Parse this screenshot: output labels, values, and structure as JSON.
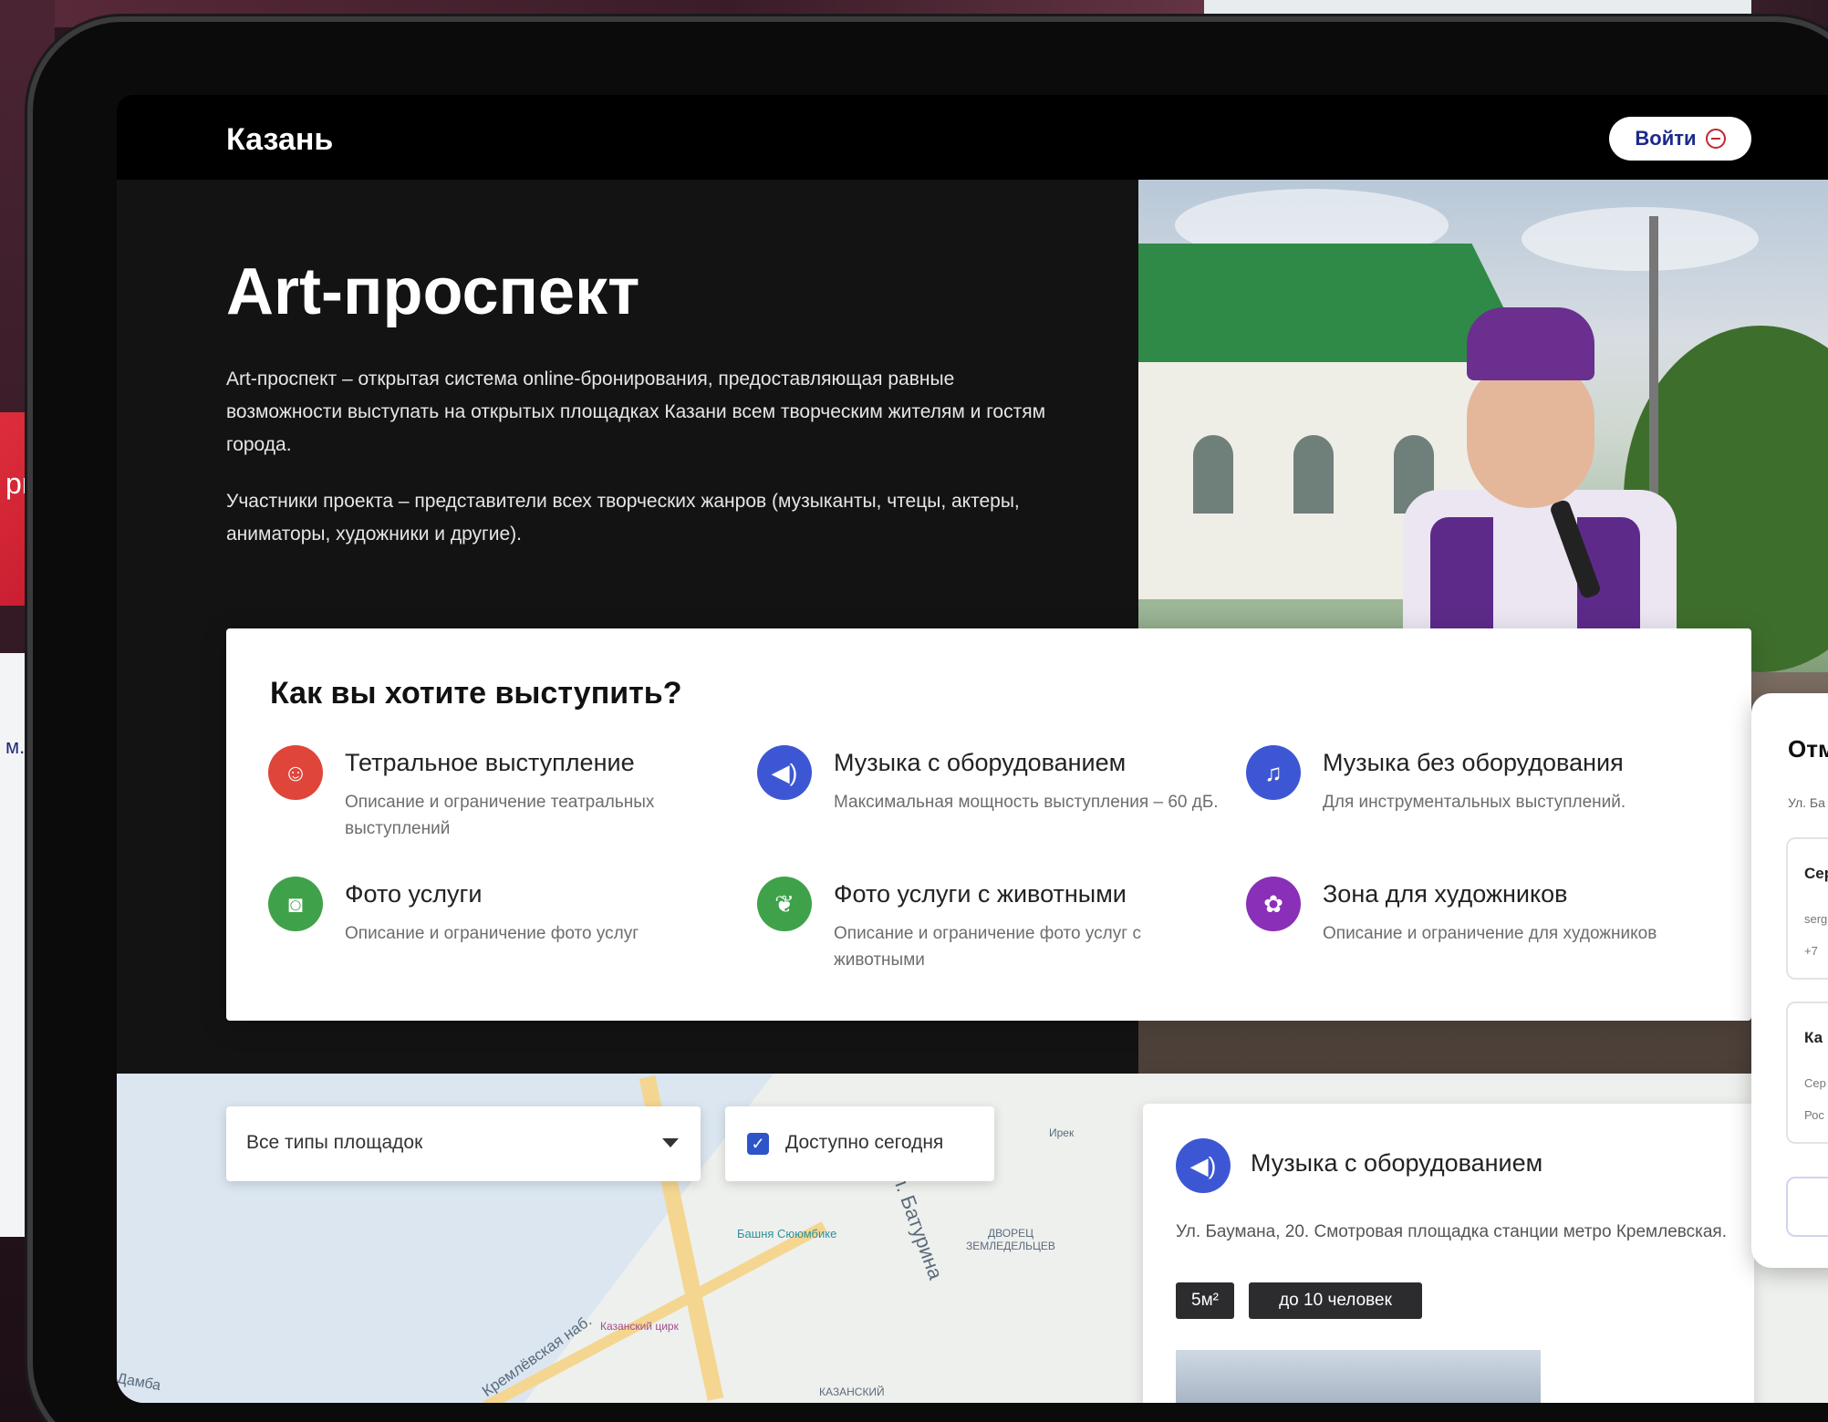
{
  "header": {
    "city": "Казань",
    "login_label": "Войти"
  },
  "hero": {
    "title": "Art-проспект",
    "description_1": "Art-проспект – открытая система online-бронирования, предоставляющая равные возможности выступать на открытых площадках Казани всем творческим жителям и гостям города.",
    "description_2": "Участники проекта – представители всех творческих жанров (музыканты, чтецы, актеры, аниматоры, художники и другие)."
  },
  "perform": {
    "title": "Как вы хотите выступить?",
    "options": [
      {
        "name": "Тетральное выступление",
        "desc": "Описание и ограничение театральных выступлений",
        "icon": "theater-mask-icon",
        "color": "#e0453a"
      },
      {
        "name": "Музыка с оборудованием",
        "desc": "Максимальная мощность выступления – 60 дБ.",
        "icon": "speaker-icon",
        "color": "#3d57d4"
      },
      {
        "name": "Музыка без оборудования",
        "desc": "Для инструментальных выступлений.",
        "icon": "music-note-icon",
        "color": "#3d57d4"
      },
      {
        "name": "Фото услуги",
        "desc": "Описание и ограничение фото услуг",
        "icon": "camera-icon",
        "color": "#3fa24a"
      },
      {
        "name": "Фото услуги с животными",
        "desc": "Описание и ограничение фото услуг с животными",
        "icon": "paw-icon",
        "color": "#3fa24a"
      },
      {
        "name": "Зона для художников",
        "desc": "Описание и ограничение для художников",
        "icon": "palette-icon",
        "color": "#8a2fb8"
      }
    ]
  },
  "filters": {
    "venue_type": "Все типы площадок",
    "available_today_label": "Доступно сегодня",
    "available_today_checked": true
  },
  "map_labels": {
    "street_1": "ул. Батурина",
    "street_2": "Кремлёвская наб.",
    "poi_1": "Башня Сююмбике",
    "poi_2": "ДВОРЕЦ ЗЕМЛЕДЕЛЬЦЕВ",
    "poi_3": "Казанский цирк",
    "poi_4": "КАЗАНСКИЙ",
    "poi_5": "Дамба",
    "poi_6": "Ирек"
  },
  "place": {
    "name": "Музыка с оборудованием",
    "address": "Ул. Баумана, 20. Смотровая площадка станции метро Кремлевская.",
    "tags": [
      "5м²",
      "до 10 человек"
    ]
  },
  "background": {
    "red_card_text": "рь",
    "mini_text": "м."
  },
  "side_panel": {
    "title": "Отм",
    "address": "Ул. Ба",
    "block_1_title": "Сер",
    "block_1_line_1": "serg",
    "block_1_line_2": "+7",
    "block_2_title": "Ка",
    "block_2_line_1": "Сер",
    "block_2_line_2": "Рос"
  }
}
